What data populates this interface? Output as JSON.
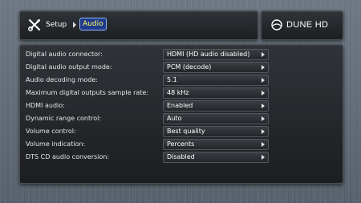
{
  "header": {
    "breadcrumb": {
      "root": "Setup",
      "current": "Audio"
    },
    "icons": {
      "setup": "tools-icon",
      "separator": "chevron-right-icon"
    }
  },
  "brand": {
    "text": "DUNE HD",
    "icon": "dune-logo-icon"
  },
  "colors": {
    "selected_crumb_bg": "#1f3a8a",
    "selected_crumb_text": "#ffff66",
    "text": "#e4e6e8"
  },
  "settings": [
    {
      "label": "Digital audio connector:",
      "value": "HDMI (HD audio disabled)"
    },
    {
      "label": "Digital audio output mode:",
      "value": "PCM (decode)"
    },
    {
      "label": "Audio decoding mode:",
      "value": "5.1"
    },
    {
      "label": "Maximum digital outputs sample rate:",
      "value": "48 kHz"
    },
    {
      "label": "HDMI audio:",
      "value": "Enabled"
    },
    {
      "label": "Dynamic range control:",
      "value": "Auto"
    },
    {
      "label": "Volume control:",
      "value": "Best quality"
    },
    {
      "label": "Volume indication:",
      "value": "Percents"
    },
    {
      "label": "DTS CD audio conversion:",
      "value": "Disabled"
    }
  ]
}
